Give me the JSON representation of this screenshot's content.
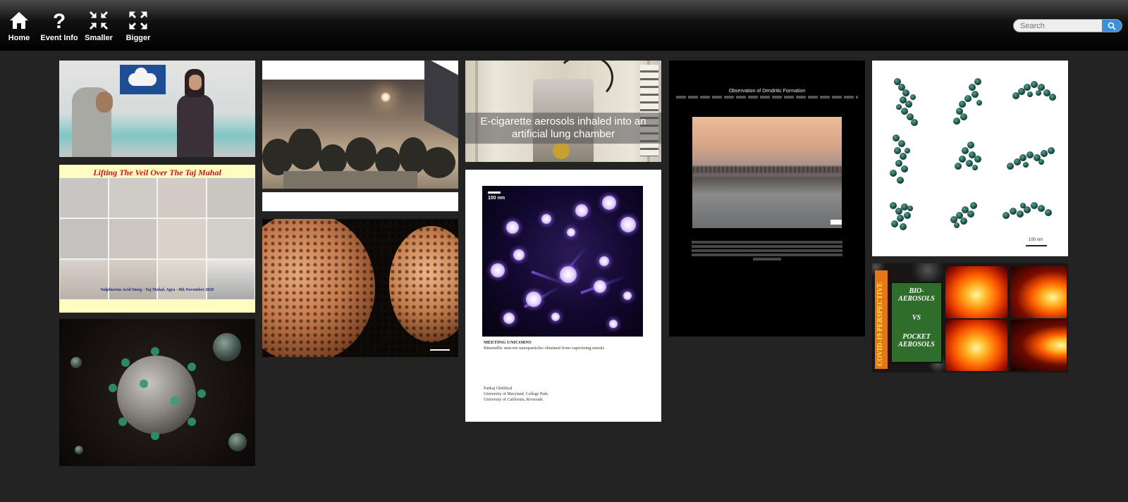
{
  "nav": {
    "home_label": "Home",
    "event_info_label": "Event Info",
    "smaller_label": "Smaller",
    "bigger_label": "Bigger"
  },
  "search": {
    "placeholder": "Search"
  },
  "colors": {
    "page_background": "#232323",
    "search_button": "#3f8fd8"
  },
  "tiles": {
    "taj_poster": {
      "title": "Lifting The Veil Over The Taj Mahal",
      "caption_heading": "Sulphurous Acid Smog - Taj Mahal, Agra - 8th November 2020"
    },
    "lung_chamber": {
      "overlay_text": "E-cigarette aerosols inhaled into an artificial lung chamber"
    },
    "unicorns": {
      "scale_label": "100 nm",
      "title": "MEETING UNICORNS",
      "subtitle": "Bimetallic unicorn nanoparticles obtained from vaporizing metals",
      "author": "Pankaj Ghildiyal",
      "affiliation_1": "University of Maryland, College Park.",
      "affiliation_2": "University of California, Riverside."
    },
    "dendritic": {
      "title": "Observation of Dendritic Formation"
    },
    "aggregates": {
      "scale_label": "100 nm"
    },
    "covid": {
      "side_text": "COVID-19 PERSPECTIVE",
      "line_1": "BIO-",
      "line_2": "AEROSOLS",
      "line_3": "VS",
      "line_4": "POCKET",
      "line_5": "AEROSOLS"
    }
  }
}
